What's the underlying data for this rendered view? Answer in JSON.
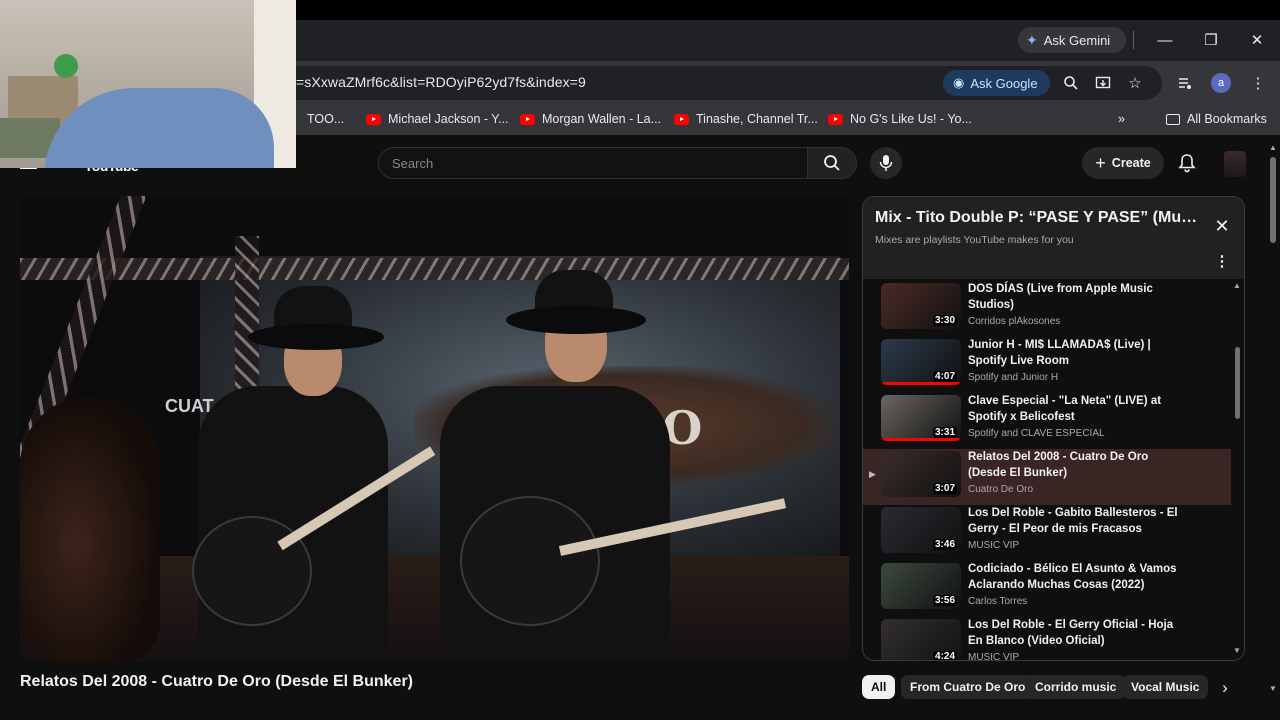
{
  "browser": {
    "url": "=sXxwaZMrf6c&list=RDOyiP62yd7fs&index=9",
    "ask_gemini": "Ask Gemini",
    "ask_google": "Ask Google",
    "profile_initial": "a",
    "bookmarks": [
      "TOO...",
      "Michael Jackson - Y...",
      "Morgan Wallen - La...",
      "Tinashe, Channel Tr...",
      "No G's Like Us! - Yo..."
    ],
    "all_bookmarks": "All Bookmarks"
  },
  "youtube": {
    "logo_text": "YouTube",
    "search_placeholder": "Search",
    "create_label": "Create"
  },
  "video": {
    "title": "Relatos Del 2008 - Cuatro De Oro (Desde El Bunker)",
    "banner_text": "ORO",
    "side_logo": "CUAT"
  },
  "playlist": {
    "title": "Mix - Tito Double P: “PASE Y PASE” (Music ...",
    "subtitle": "Mixes are playlists YouTube makes for you",
    "items": [
      {
        "title": "DOS DÍAS (Live from Apple Music Studios)",
        "channel": "Corridos plAkosones",
        "duration": "3:30",
        "thumb": "#4a2a26",
        "progress": 0
      },
      {
        "title": "Junior H - MI$ LLAMADA$ (Live) | Spotify Live Room",
        "channel": "Spotify and Junior H",
        "duration": "4:07",
        "thumb": "#2b3a4a",
        "progress": 1.0
      },
      {
        "title": "Clave Especial - \"La Neta\" (LIVE) at Spotify x Belicofest",
        "channel": "Spotify and CLAVE ESPECIAL",
        "duration": "3:31",
        "thumb": "#6a6660",
        "progress": 1.0
      },
      {
        "title": "Relatos Del 2008 - Cuatro De Oro (Desde El Bunker)",
        "channel": "Cuatro De Oro",
        "duration": "3:07",
        "thumb": "#3a2d2a",
        "progress": 0
      },
      {
        "title": "Los Del Roble - Gabito Ballesteros - El Gerry - El Peor de mis Fracasos",
        "channel": "MUSIC VIP",
        "duration": "3:46",
        "thumb": "#2a2a33",
        "progress": 0
      },
      {
        "title": "Codiciado - Bélico El Asunto & Vamos Aclarando Muchas Cosas (2022)",
        "channel": "Carlos Torres",
        "duration": "3:56",
        "thumb": "#3c4a40",
        "progress": 0
      },
      {
        "title": "Los Del Roble - El Gerry Oficial - Hoja En Blanco (Video Oficial)",
        "channel": "MUSIC VIP",
        "duration": "4:24",
        "thumb": "#33302e",
        "progress": 0
      }
    ]
  },
  "chips": [
    "All",
    "From Cuatro De Oro",
    "Corrido music",
    "Vocal Music"
  ],
  "colors": {
    "accent_red": "#ff0000",
    "active_row": "#3a2424"
  }
}
